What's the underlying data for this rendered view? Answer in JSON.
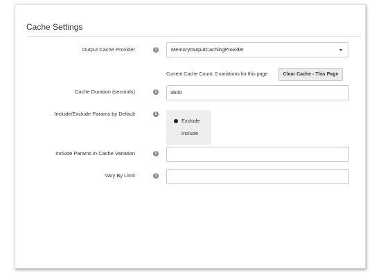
{
  "section": {
    "title": "Cache Settings"
  },
  "fields": {
    "output_cache_provider": {
      "label": "Output Cache Provider",
      "value": "MemoryOutputCachingProvider"
    },
    "cache_count": {
      "text": "Current Cache Count: 0 variations for this page",
      "clear_button": "Clear Cache - This Page"
    },
    "cache_duration": {
      "label": "Cache Duration (seconds)",
      "value": "3600"
    },
    "include_exclude": {
      "label": "Include/Exclude Params by Default",
      "options": [
        "Exclude",
        "Include"
      ],
      "selected": "Exclude"
    },
    "include_params": {
      "label": "Include Params in Cache Variation",
      "value": ""
    },
    "vary_by_limit": {
      "label": "Vary By Limit",
      "value": ""
    }
  },
  "icons": {
    "info": "info-icon",
    "dropdown": "chevron-down-icon"
  },
  "info_glyph": "i",
  "colors": {
    "panel_border": "#dcdcdc",
    "button_bg": "#ececec",
    "radio_group_bg": "#eeeeee"
  }
}
